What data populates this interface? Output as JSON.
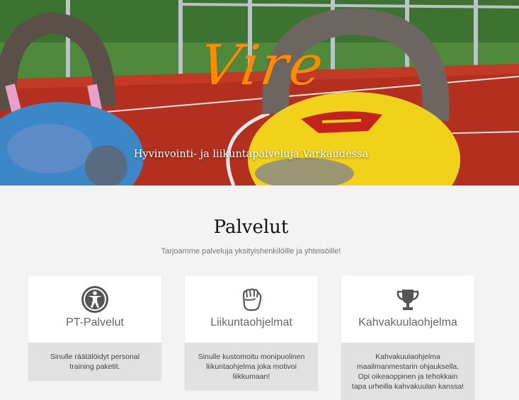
{
  "hero": {
    "brand": "Vire",
    "tagline": "Hyvinvointi- ja liikuntapalveluja Varkaudessa"
  },
  "services": {
    "title": "Palvelut",
    "subtitle": "Tarjoamme palveluja yksityishenkilöille ja yhteisöille!",
    "cards": [
      {
        "icon": "accessibility-person-icon",
        "title": "PT-Palvelut",
        "description": "Sinulle räätälöidyt personal training paketit."
      },
      {
        "icon": "fist-icon",
        "title": "Liikuntaohjelmat",
        "description": "Sinulle kustomoitu monipuolinen liikuntaohjelma joka motivoi liikkumaan!"
      },
      {
        "icon": "trophy-icon",
        "title": "Kahvakuulaohjelma",
        "description": "Kahvakuulaohjelma maailmanmestarin ohjauksella. Opi oikeaoppinen ja tehokkain tapa urheilla kahvakuulan kanssa!"
      }
    ]
  },
  "colors": {
    "brand": "#ff8a00",
    "background": "#f3f3f3",
    "card_description_bg": "#e1e1e1",
    "icon": "#555555"
  }
}
